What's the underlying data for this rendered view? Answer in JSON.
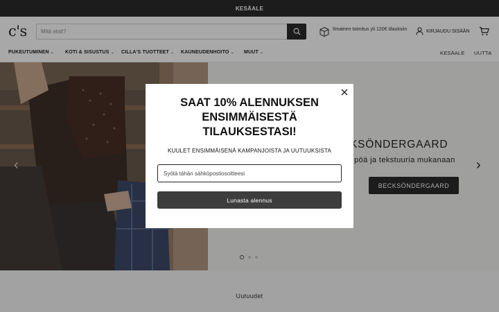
{
  "announcement": "KESÄALE",
  "header": {
    "logo": "c's",
    "search": {
      "placeholder": "Mitä etsit?",
      "value": ""
    },
    "shipping_text": "Ilmainen toimitus yli 120€ tilauksiin",
    "login_label": "KIRJAUDU SISÄÄN"
  },
  "nav": {
    "items": [
      {
        "label": "PUKEUTUMINEN"
      },
      {
        "label": "KOTI & SISUSTUS"
      },
      {
        "label": "CILLA'S TUOTTEET"
      },
      {
        "label": "KAUNEUDENHOITO"
      },
      {
        "label": "MUUT"
      }
    ],
    "right": [
      {
        "label": "KESÄALE"
      },
      {
        "label": "UUTTA"
      }
    ]
  },
  "hero": {
    "title": "BECKSÖNDERGAARD",
    "title_visible": "CKSÖNDERGAARD",
    "subtitle_visible": "ampöä ja tekstuuria mukanaan",
    "button_label": "BECKSÖNDERGAARD",
    "slides": 3,
    "active_slide": 1
  },
  "section": {
    "title": "Uutuudet"
  },
  "popup": {
    "heading": "SAAT 10% ALENNUKSEN ENSIMMÄISESTÄ TILAUKSESTASI!",
    "subheading": "KUULET ENSIMMÄISENÄ KAMPANJOISTA JA UUTUUKSISTA",
    "email_placeholder": "Syötä tähän sähköpostiosoitteesi",
    "email_value": "",
    "submit_label": "Lunasta alennus"
  },
  "colors": {
    "dark": "#2b2b2b",
    "button": "#3d3d3d",
    "overlay": "rgba(0,0,0,0.34)"
  },
  "icons": [
    "search-icon",
    "box-icon",
    "user-icon",
    "cart-icon",
    "chevron-down-icon",
    "arrow-left-icon",
    "arrow-right-icon",
    "close-icon"
  ]
}
